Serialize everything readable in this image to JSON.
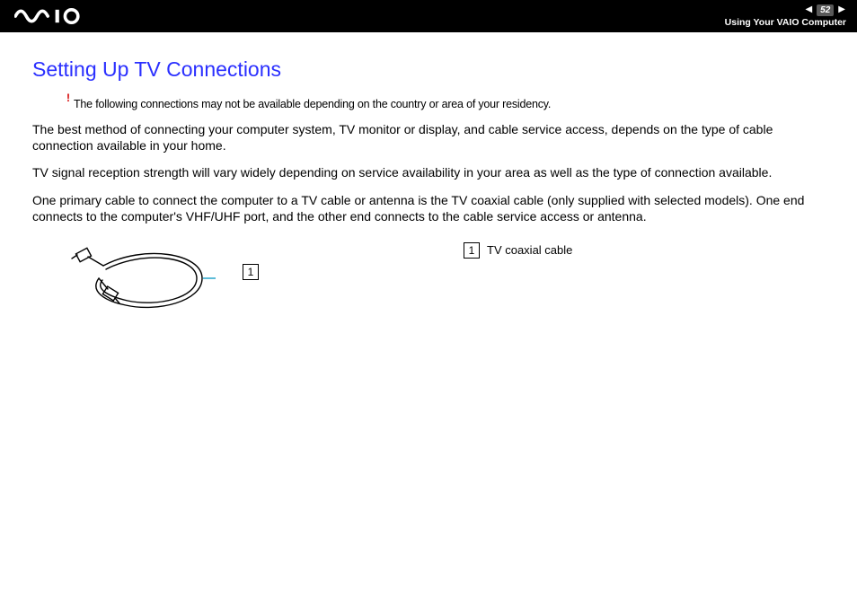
{
  "header": {
    "page_number": "52",
    "section": "Using Your VAIO Computer"
  },
  "title": "Setting Up TV Connections",
  "alert": {
    "mark": "!",
    "text": "The following connections may not be available depending on the country or area of your residency."
  },
  "paragraphs": {
    "p1": "The best method of connecting your computer system, TV monitor or display, and cable service access, depends on the type of cable connection available in your home.",
    "p2": "TV signal reception strength will vary widely depending on service availability in your area as well as the type of connection available.",
    "p3": "One primary cable to connect the computer to a TV cable or antenna is the TV coaxial cable (only supplied with selected models). One end connects to the computer's VHF/UHF port, and the other end connects to the cable service access or antenna."
  },
  "figure": {
    "callout_num": "1",
    "legend_num": "1",
    "legend_text": "TV coaxial cable"
  }
}
